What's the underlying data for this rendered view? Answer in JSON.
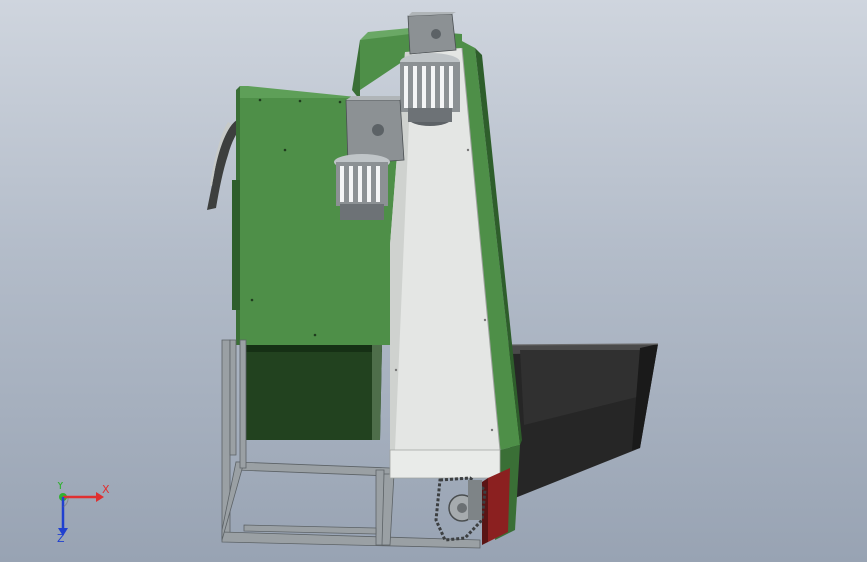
{
  "viewport": {
    "background_top": "#cfd5de",
    "background_bottom": "#98a3b3"
  },
  "model": {
    "colors": {
      "panel_green": "#4e8f48",
      "panel_green_dark": "#2e5e2b",
      "panel_green_shadow": "#1f3d1e",
      "belt_white": "#e4e6e4",
      "frame_grey": "#9aa0a4",
      "motor_grey": "#8c9194",
      "hopper_black": "#2a2a2a",
      "edge_red": "#8b2020"
    },
    "parts": [
      "rear-housing",
      "conveyor-belt",
      "upper-motor",
      "lower-motor",
      "discharge-hopper",
      "support-frame",
      "drive-sprocket",
      "feed-guard"
    ]
  },
  "triad": {
    "x_label": "X",
    "y_label": "Y",
    "z_label": "Z",
    "x_color": "#e03030",
    "y_color": "#30b030",
    "z_color": "#2040d0"
  }
}
